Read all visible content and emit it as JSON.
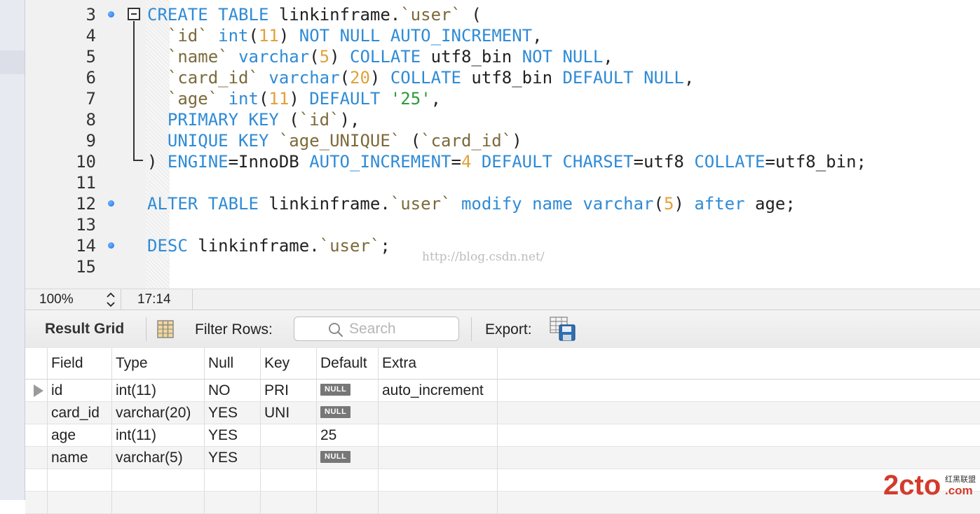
{
  "editor": {
    "lines": [
      {
        "num": "3",
        "marker": true,
        "segments": [
          {
            "t": "CREATE TABLE ",
            "c": "kw"
          },
          {
            "t": "linkinframe.",
            "c": ""
          },
          {
            "t": "`user`",
            "c": "str"
          },
          {
            "t": " (",
            "c": ""
          }
        ]
      },
      {
        "num": "4",
        "marker": false,
        "segments": [
          {
            "t": "  ",
            "c": ""
          },
          {
            "t": "`id`",
            "c": "str"
          },
          {
            "t": " ",
            "c": ""
          },
          {
            "t": "int",
            "c": "fn"
          },
          {
            "t": "(",
            "c": ""
          },
          {
            "t": "11",
            "c": "num"
          },
          {
            "t": ") ",
            "c": ""
          },
          {
            "t": "NOT NULL AUTO_INCREMENT",
            "c": "kw"
          },
          {
            "t": ",",
            "c": ""
          }
        ]
      },
      {
        "num": "5",
        "marker": false,
        "segments": [
          {
            "t": "  ",
            "c": ""
          },
          {
            "t": "`name`",
            "c": "str"
          },
          {
            "t": " ",
            "c": ""
          },
          {
            "t": "varchar",
            "c": "fn"
          },
          {
            "t": "(",
            "c": ""
          },
          {
            "t": "5",
            "c": "num"
          },
          {
            "t": ") ",
            "c": ""
          },
          {
            "t": "COLLATE",
            "c": "kw"
          },
          {
            "t": " utf8_bin ",
            "c": ""
          },
          {
            "t": "NOT NULL",
            "c": "kw"
          },
          {
            "t": ",",
            "c": ""
          }
        ]
      },
      {
        "num": "6",
        "marker": false,
        "segments": [
          {
            "t": "  ",
            "c": ""
          },
          {
            "t": "`card_id`",
            "c": "str"
          },
          {
            "t": " ",
            "c": ""
          },
          {
            "t": "varchar",
            "c": "fn"
          },
          {
            "t": "(",
            "c": ""
          },
          {
            "t": "20",
            "c": "num"
          },
          {
            "t": ") ",
            "c": ""
          },
          {
            "t": "COLLATE",
            "c": "kw"
          },
          {
            "t": " utf8_bin ",
            "c": ""
          },
          {
            "t": "DEFAULT NULL",
            "c": "kw"
          },
          {
            "t": ",",
            "c": ""
          }
        ]
      },
      {
        "num": "7",
        "marker": false,
        "segments": [
          {
            "t": "  ",
            "c": ""
          },
          {
            "t": "`age`",
            "c": "str"
          },
          {
            "t": " ",
            "c": ""
          },
          {
            "t": "int",
            "c": "fn"
          },
          {
            "t": "(",
            "c": ""
          },
          {
            "t": "11",
            "c": "num"
          },
          {
            "t": ") ",
            "c": ""
          },
          {
            "t": "DEFAULT",
            "c": "kw"
          },
          {
            "t": " ",
            "c": ""
          },
          {
            "t": "'25'",
            "c": "strg"
          },
          {
            "t": ",",
            "c": ""
          }
        ]
      },
      {
        "num": "8",
        "marker": false,
        "segments": [
          {
            "t": "  ",
            "c": ""
          },
          {
            "t": "PRIMARY KEY",
            "c": "kw"
          },
          {
            "t": " (",
            "c": ""
          },
          {
            "t": "`id`",
            "c": "str"
          },
          {
            "t": "),",
            "c": ""
          }
        ]
      },
      {
        "num": "9",
        "marker": false,
        "segments": [
          {
            "t": "  ",
            "c": ""
          },
          {
            "t": "UNIQUE KEY",
            "c": "kw"
          },
          {
            "t": " ",
            "c": ""
          },
          {
            "t": "`age_UNIQUE`",
            "c": "str"
          },
          {
            "t": " (",
            "c": ""
          },
          {
            "t": "`card_id`",
            "c": "str"
          },
          {
            "t": ")",
            "c": ""
          }
        ]
      },
      {
        "num": "10",
        "marker": false,
        "segments": [
          {
            "t": ") ",
            "c": ""
          },
          {
            "t": "ENGINE",
            "c": "kw"
          },
          {
            "t": "=InnoDB ",
            "c": ""
          },
          {
            "t": "AUTO_INCREMENT",
            "c": "kw"
          },
          {
            "t": "=",
            "c": ""
          },
          {
            "t": "4",
            "c": "num"
          },
          {
            "t": " ",
            "c": ""
          },
          {
            "t": "DEFAULT CHARSET",
            "c": "kw"
          },
          {
            "t": "=utf8 ",
            "c": ""
          },
          {
            "t": "COLLATE",
            "c": "kw"
          },
          {
            "t": "=utf8_bin;",
            "c": ""
          }
        ]
      },
      {
        "num": "11",
        "marker": false,
        "segments": []
      },
      {
        "num": "12",
        "marker": true,
        "segments": [
          {
            "t": "ALTER TABLE ",
            "c": "kw"
          },
          {
            "t": "linkinframe.",
            "c": ""
          },
          {
            "t": "`user`",
            "c": "str"
          },
          {
            "t": " ",
            "c": ""
          },
          {
            "t": "modify",
            "c": "kw"
          },
          {
            "t": " ",
            "c": ""
          },
          {
            "t": "name",
            "c": "kw"
          },
          {
            "t": " ",
            "c": ""
          },
          {
            "t": "varchar",
            "c": "fn"
          },
          {
            "t": "(",
            "c": ""
          },
          {
            "t": "5",
            "c": "num"
          },
          {
            "t": ") ",
            "c": ""
          },
          {
            "t": "after",
            "c": "kw"
          },
          {
            "t": " age;",
            "c": ""
          }
        ]
      },
      {
        "num": "13",
        "marker": false,
        "segments": []
      },
      {
        "num": "14",
        "marker": true,
        "segments": [
          {
            "t": "DESC",
            "c": "kw"
          },
          {
            "t": " linkinframe.",
            "c": ""
          },
          {
            "t": "`user`",
            "c": "str"
          },
          {
            "t": ";",
            "c": ""
          }
        ]
      },
      {
        "num": "15",
        "marker": false,
        "segments": []
      }
    ],
    "watermark": "http://blog.csdn.net/"
  },
  "status_bar": {
    "zoom": "100%",
    "cursor": "17:14"
  },
  "result_toolbar": {
    "title": "Result Grid",
    "filter_label": "Filter Rows:",
    "search_placeholder": "Search",
    "export_label": "Export:"
  },
  "result_grid": {
    "columns": [
      "Field",
      "Type",
      "Null",
      "Key",
      "Default",
      "Extra"
    ],
    "null_label": "NULL",
    "rows": [
      {
        "field": "id",
        "type": "int(11)",
        "null": "NO",
        "key": "PRI",
        "default": null,
        "extra": "auto_increment",
        "selected": true
      },
      {
        "field": "card_id",
        "type": "varchar(20)",
        "null": "YES",
        "key": "UNI",
        "default": null,
        "extra": "",
        "selected": false
      },
      {
        "field": "age",
        "type": "int(11)",
        "null": "YES",
        "key": "",
        "default": "25",
        "extra": "",
        "selected": false
      },
      {
        "field": "name",
        "type": "varchar(5)",
        "null": "YES",
        "key": "",
        "default": null,
        "extra": "",
        "selected": false
      }
    ]
  },
  "colors": {
    "keyword": "#2f8bd6",
    "number": "#e2a13a",
    "identifier": "#7b6a3a",
    "string": "#2d9a3a",
    "breakpoint": "#1a73e8"
  },
  "icons": {
    "fold": "collapse-box-icon",
    "search": "magnifier-icon",
    "grid": "grid-columns-icon",
    "export": "export-save-icon",
    "zoom_stepper": "up-down-chevrons-icon"
  },
  "brand": {
    "logo_text": "2cto",
    "logo_sub": "红黑联盟",
    "logo_tld": ".com"
  }
}
